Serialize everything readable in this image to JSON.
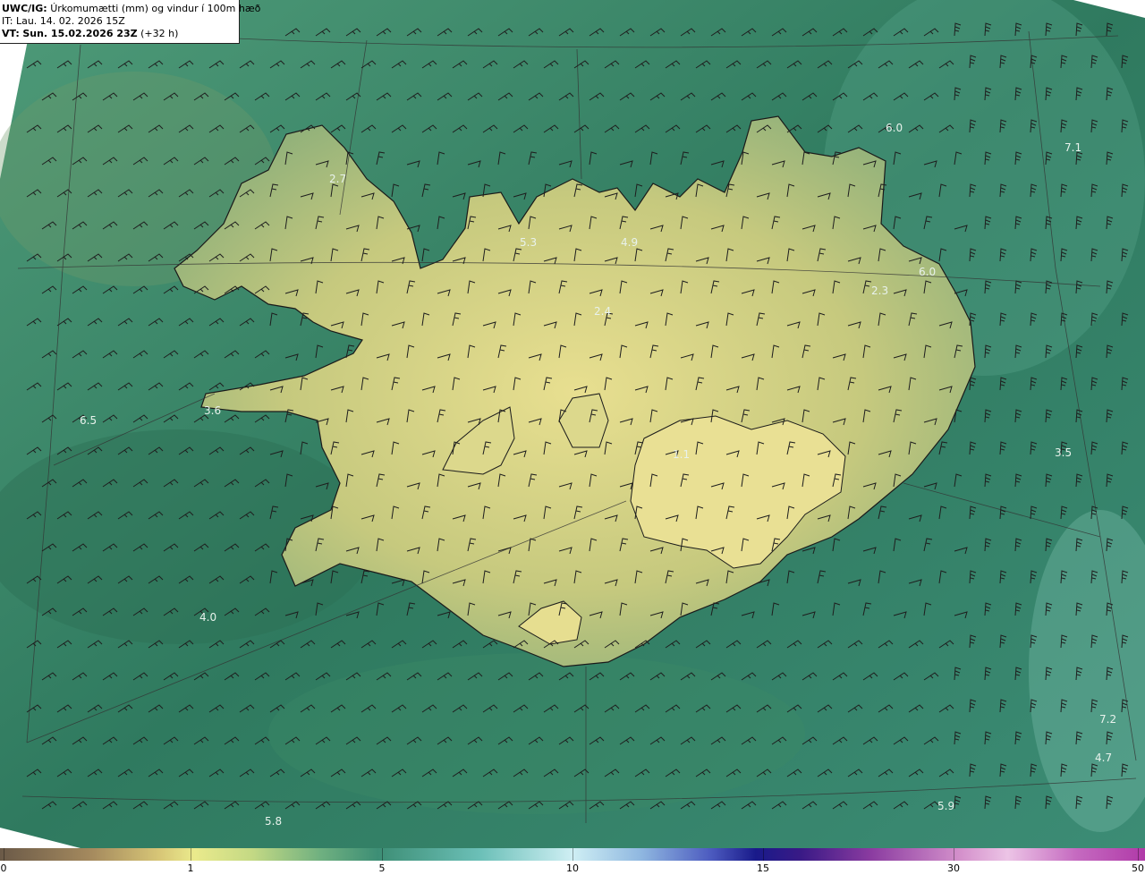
{
  "header": {
    "model": "UWC/IG:",
    "product": "Úrkomumætti (mm) og vindur í 100m hæð",
    "init_label": "IT:",
    "init_time": "Lau. 14. 02. 2026 15Z",
    "valid_label": "VT:",
    "valid_time": "Sun. 15.02.2026 23Z",
    "lead_time": "(+32 h)"
  },
  "map_labels": [
    {
      "text": "6.0",
      "id": "label-ne-1"
    },
    {
      "text": "7.1",
      "id": "label-ne-2"
    },
    {
      "text": "2.7",
      "id": "label-westfjords"
    },
    {
      "text": "5.3",
      "id": "label-north-1"
    },
    {
      "text": "4.9",
      "id": "label-north-2"
    },
    {
      "text": "6.0",
      "id": "label-east-1"
    },
    {
      "text": "2.3",
      "id": "label-east-2"
    },
    {
      "text": "2.4",
      "id": "label-central-north"
    },
    {
      "text": "3.6",
      "id": "label-snaefellsnes"
    },
    {
      "text": "6.5",
      "id": "label-west-sea"
    },
    {
      "text": "1.1",
      "id": "label-vatnajokull"
    },
    {
      "text": "3.5",
      "id": "label-east-sea"
    },
    {
      "text": "4.0",
      "id": "label-sw-sea"
    },
    {
      "text": "7.2",
      "id": "label-se-sea-1"
    },
    {
      "text": "4.7",
      "id": "label-se-sea-2"
    },
    {
      "text": "5.9",
      "id": "label-south-sea"
    },
    {
      "text": "5.8",
      "id": "label-sw-sea-2"
    }
  ],
  "colorbar": {
    "ticks": [
      {
        "label": "0",
        "value": 0
      },
      {
        "label": "1",
        "value": 1
      },
      {
        "label": "5",
        "value": 5
      },
      {
        "label": "10",
        "value": 10
      },
      {
        "label": "15",
        "value": 15
      },
      {
        "label": "30",
        "value": 30
      },
      {
        "label": "50",
        "value": 50
      }
    ]
  },
  "colors": {
    "sea": "#3f8a6e",
    "land_low": "#d9d985",
    "land_high": "#e6df90",
    "coastline": "#1a1a1a",
    "grid": "#333333"
  }
}
